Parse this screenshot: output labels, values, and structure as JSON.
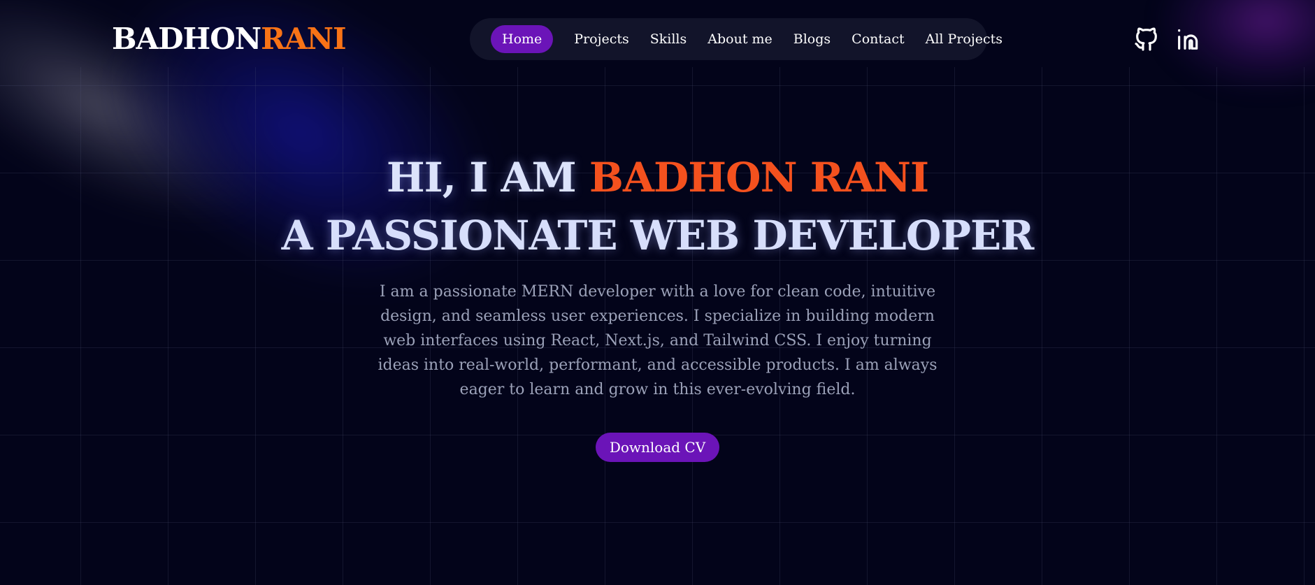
{
  "header": {
    "logo_first": "BADHON",
    "logo_second": "RANI",
    "nav": [
      {
        "label": "Home",
        "active": true
      },
      {
        "label": "Projects"
      },
      {
        "label": "Skills"
      },
      {
        "label": "About me"
      },
      {
        "label": "Blogs"
      },
      {
        "label": "Contact"
      },
      {
        "label": "All Projects"
      }
    ],
    "social_icons": [
      "github-icon",
      "linkedin-icon"
    ]
  },
  "hero": {
    "greeting": "HI, I AM ",
    "name": "BADHON RANI",
    "tagline": "A PASSIONATE WEB DEVELOPER",
    "description": "I am a passionate MERN developer with a love for clean code, intuitive design, and seamless user experiences. I specialize in building modern web interfaces using React, Next.js, and Tailwind CSS. I enjoy turning ideas into real-world, performant, and accessible products. I am always eager to learn and grow in this ever-evolving field.",
    "cv_button": "Download CV"
  },
  "colors": {
    "background": "#03041a",
    "accent_purple": "#6b14b8",
    "accent_orange": "#f97316",
    "name_orange": "#f4511e",
    "nav_bg": "#12142a"
  }
}
